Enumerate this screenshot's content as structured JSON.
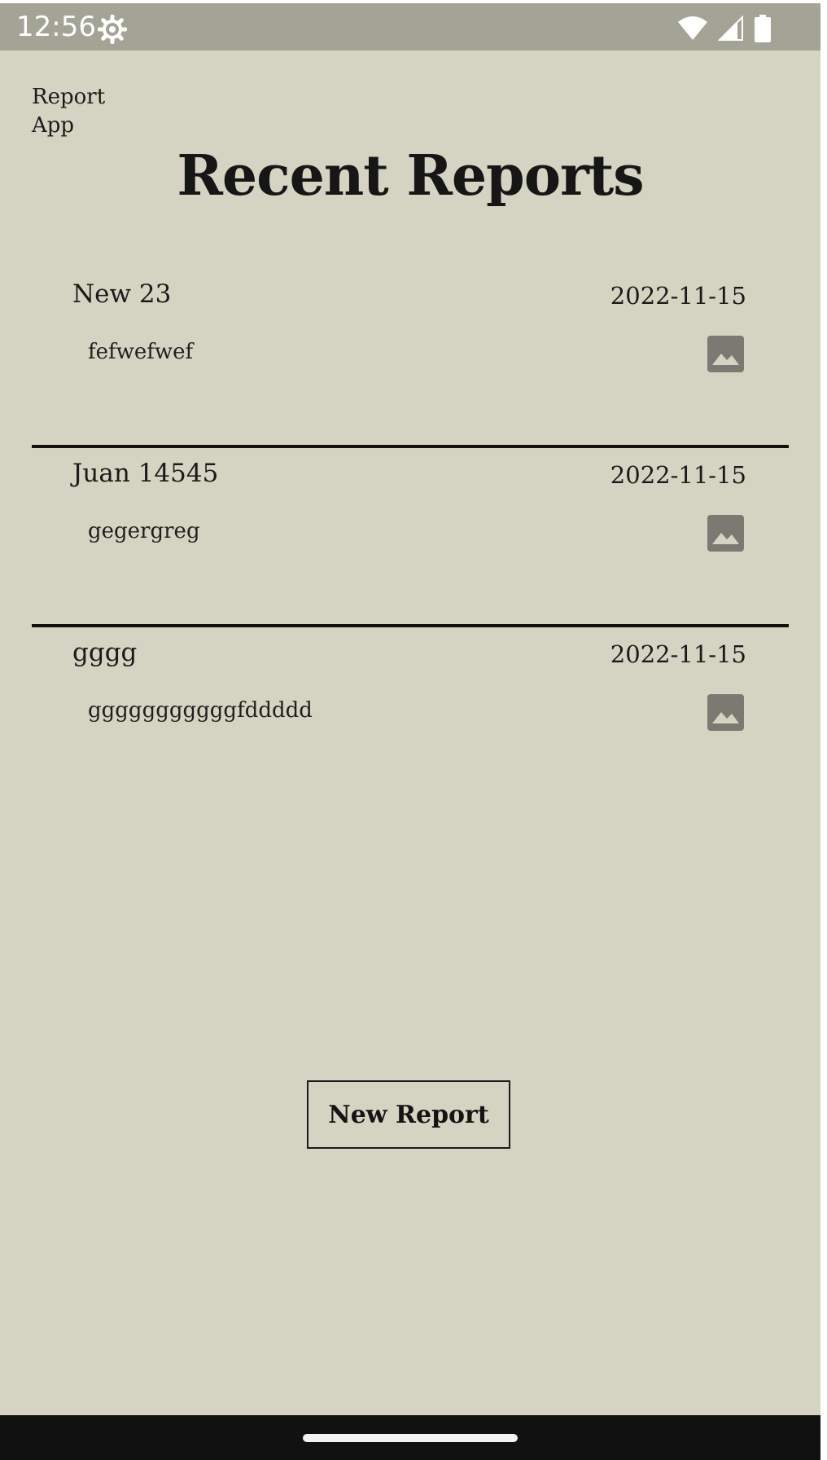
{
  "status_bar": {
    "time": "12:56",
    "icons": [
      "settings-gear-icon",
      "wifi-icon",
      "cell-signal-icon",
      "battery-icon"
    ]
  },
  "header": {
    "app_name": "Report App",
    "title": "Recent Reports"
  },
  "reports": [
    {
      "name": "New 23",
      "date": "2022-11-15",
      "description": "fefwefwef",
      "icon": "image-icon"
    },
    {
      "name": "Juan 14545",
      "date": "2022-11-15",
      "description": "gegergreg",
      "icon": "image-icon"
    },
    {
      "name": "gggg",
      "date": "2022-11-15",
      "description": "gggggggggggfddddd",
      "icon": "image-icon"
    }
  ],
  "actions": {
    "new_report_label": "New Report"
  },
  "colors": {
    "background": "#d5d4c2",
    "status_bar": "#a3a396",
    "divider": "#111111",
    "icon": "#7a7a72"
  }
}
